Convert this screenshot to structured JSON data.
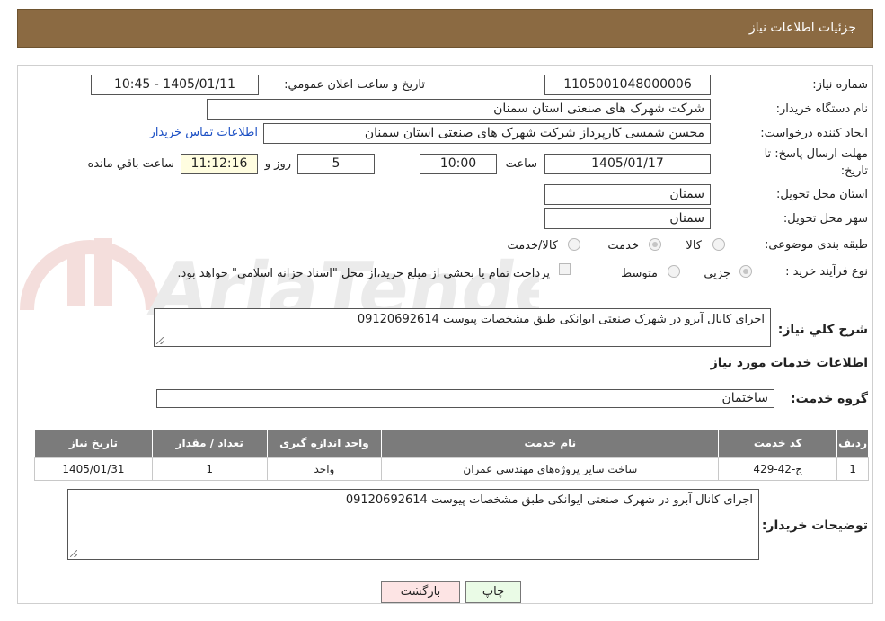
{
  "header": {
    "title": "جزئیات اطلاعات نیاز"
  },
  "fields": {
    "need_number_label": "شماره نیاز:",
    "need_number_value": "1105001048000006",
    "announce_label": "تاریخ و ساعت اعلان عمومي:",
    "announce_value": "1405/01/11 - 10:45",
    "buyer_org_label": "نام دستگاه خريدار:",
    "buyer_org_value": "شركت شهرک های صنعتی استان سمنان",
    "requester_label": "ايجاد كننده درخواست:",
    "requester_value": "محسن شمسی کارپرداز شرکت شهرک های صنعتی استان سمنان",
    "contact_link": "اطلاعات تماس خريدار",
    "deadline_label_1": "مهلت ارسال پاسخ: تا",
    "deadline_label_2": "تاريخ:",
    "deadline_date": "1405/01/17",
    "time_label": "ساعت",
    "deadline_time": "10:00",
    "days_value": "5",
    "days_label": "روز و",
    "remaining_time": "11:12:16",
    "remaining_label": "ساعت باقي مانده",
    "province_label": "استان محل تحويل:",
    "province_value": "سمنان",
    "city_label": "شهر محل تحويل:",
    "city_value": "سمنان",
    "category_label": "طبقه بندی موضوعی:",
    "category_options": [
      "كالا",
      "خدمت",
      "كالا/خدمت"
    ],
    "category_selected": "خدمت",
    "process_label": "نوع فرآيند خريد :",
    "process_options": [
      "جزيي",
      "متوسط"
    ],
    "process_selected": "جزيي",
    "payment_note": "پرداخت تمام یا بخشی از مبلغ خرید،از محل \"اسناد خزانه اسلامی\" خواهد بود.",
    "description_label": "شرح كلي نياز:",
    "description_value": "اجرای کانال آبرو در شهرک صنعتی ایوانکی طبق مشخصات پیوست 09120692614",
    "services_heading": "اطلاعات خدمات مورد نياز",
    "service_group_label": "گروه خدمت:",
    "service_group_value": "ساختمان"
  },
  "table": {
    "headers": [
      "رديف",
      "كد خدمت",
      "نام خدمت",
      "واحد اندازه گيری",
      "تعداد / مقدار",
      "تاريخ نياز"
    ],
    "rows": [
      [
        "1",
        "ج-42-429",
        "ساخت سایر پروژه‌های مهندسی عمران",
        "واحد",
        "1",
        "1405/01/31"
      ]
    ]
  },
  "buyer_notes": {
    "label": "توضيحات خريدار:",
    "value": "اجرای کانال آبرو در شهرک صنعتی ایوانکی طبق مشخصات پیوست 09120692614"
  },
  "buttons": {
    "print": "چاپ",
    "back": "بازگشت"
  },
  "colors": {
    "header_bg": "#8b6a42",
    "table_header_bg": "#7b7b7b",
    "print_btn_bg": "#eafbe6",
    "back_btn_bg": "#fde4e4",
    "link": "#1b4fc4"
  },
  "watermark": {
    "text": "AriaTender.neT"
  }
}
